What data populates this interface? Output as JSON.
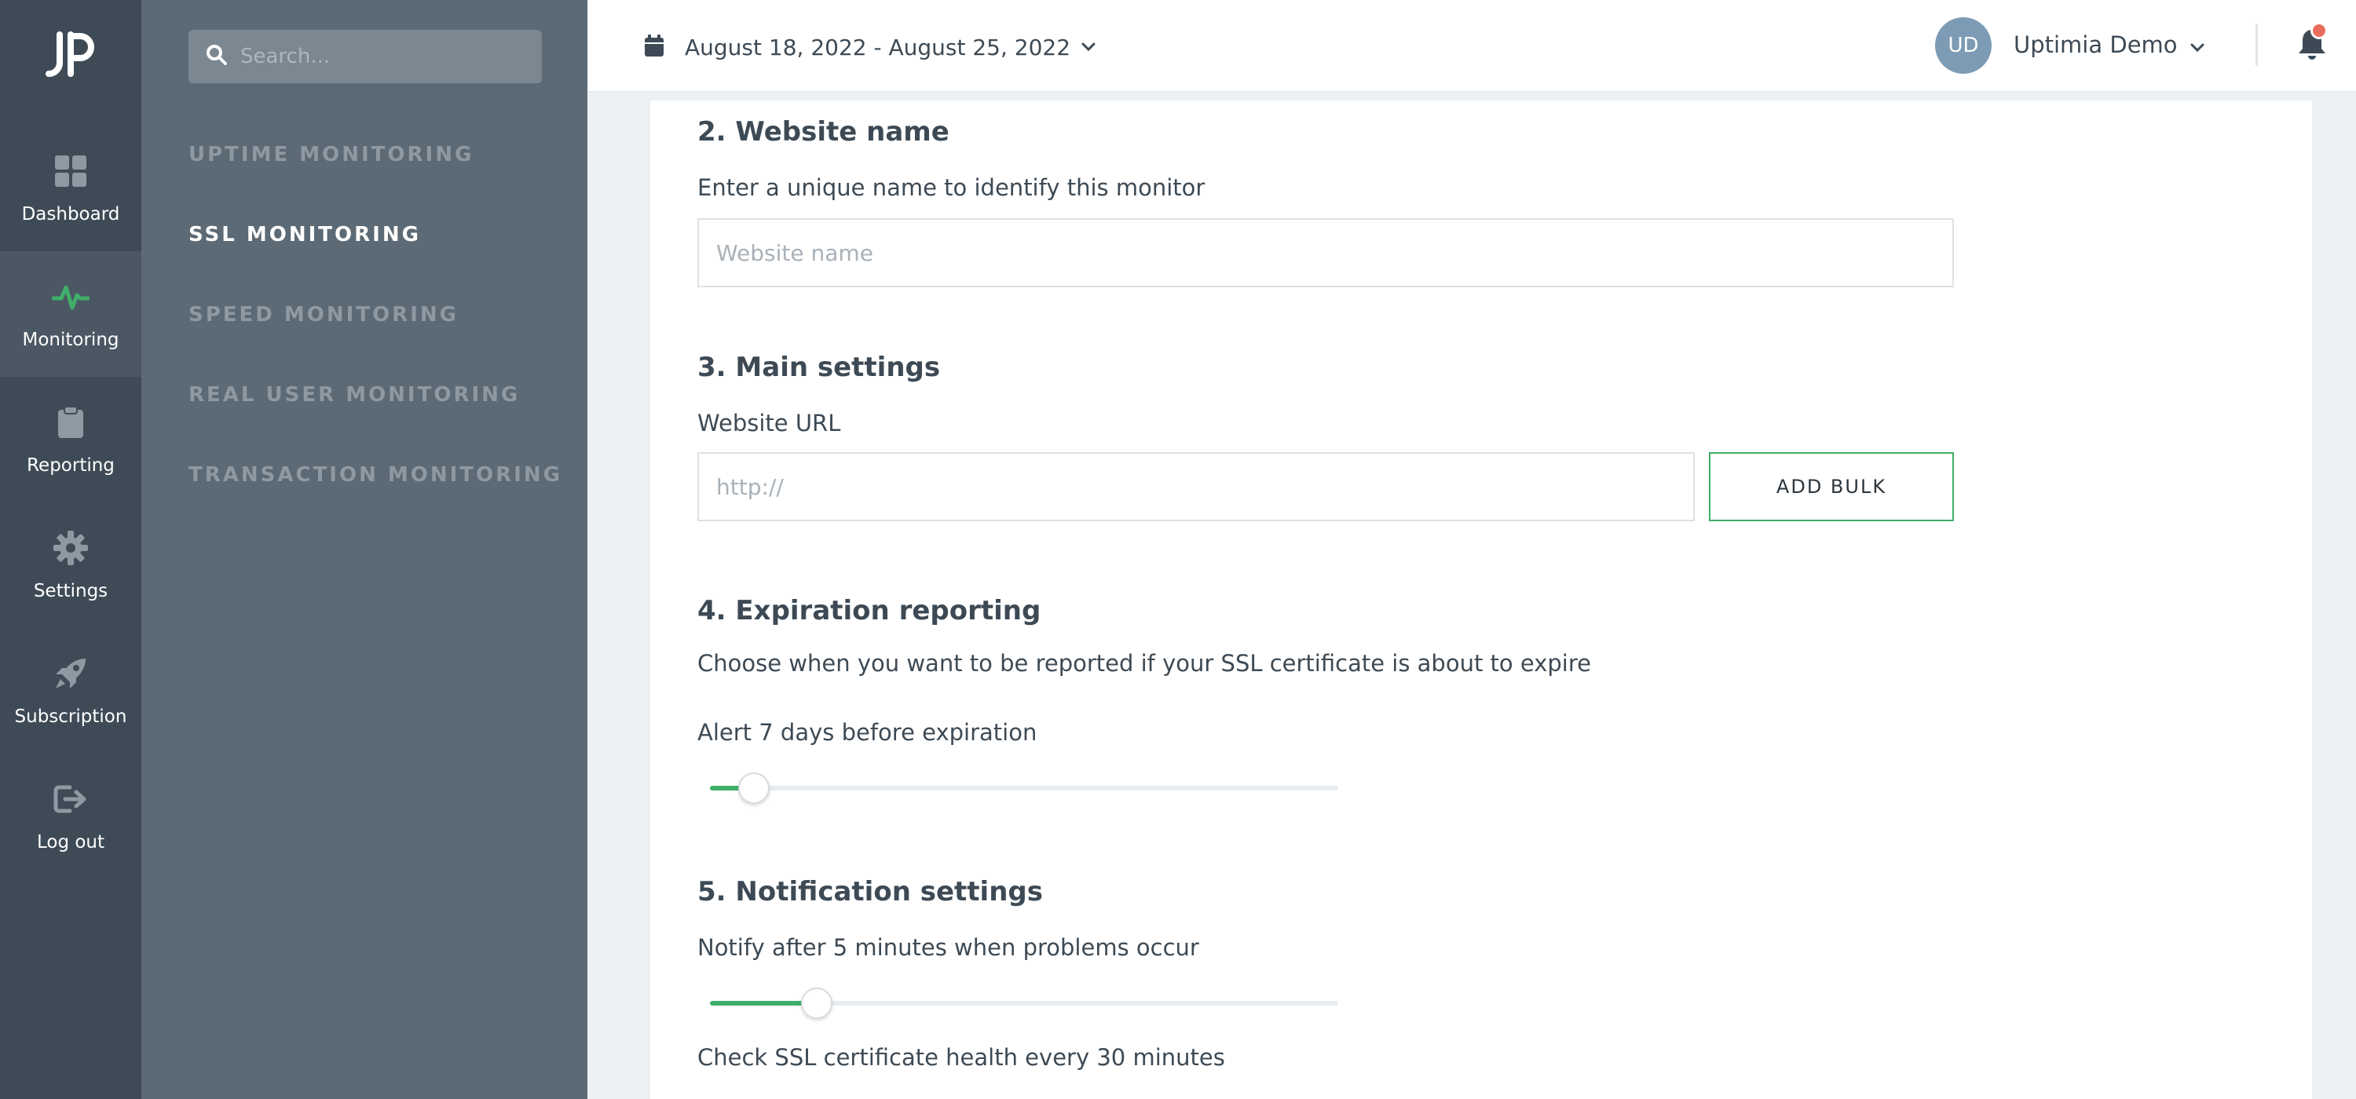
{
  "rail": {
    "items": [
      {
        "label": "Dashboard",
        "icon": "dashboard-icon"
      },
      {
        "label": "Monitoring",
        "icon": "pulse-icon"
      },
      {
        "label": "Reporting",
        "icon": "clipboard-icon"
      },
      {
        "label": "Settings",
        "icon": "gear-icon"
      },
      {
        "label": "Subscription",
        "icon": "rocket-icon"
      },
      {
        "label": "Log out",
        "icon": "logout-icon"
      }
    ]
  },
  "search": {
    "placeholder": "Search..."
  },
  "subnav": {
    "items": [
      {
        "label": "UPTIME MONITORING"
      },
      {
        "label": "SSL MONITORING"
      },
      {
        "label": "SPEED MONITORING"
      },
      {
        "label": "REAL USER MONITORING"
      },
      {
        "label": "TRANSACTION MONITORING"
      }
    ]
  },
  "header": {
    "date_range": "August 18, 2022 - August 25, 2022",
    "avatar_initials": "UD",
    "user_name": "Uptimia Demo"
  },
  "form": {
    "website_name": {
      "title": "2. Website name",
      "description": "Enter a unique name to identify this monitor",
      "placeholder": "Website name"
    },
    "main_settings": {
      "title": "3. Main settings",
      "url_label": "Website URL",
      "url_placeholder": "http://",
      "add_bulk_label": "ADD BULK"
    },
    "expiration": {
      "title": "4. Expiration reporting",
      "description": "Choose when you want to be reported if your SSL certificate is about to expire",
      "alert_label": "Alert 7 days before expiration",
      "alert_slider_fraction": 0.07
    },
    "notification": {
      "title": "5. Notification settings",
      "notify_label": "Notify after 5 minutes when problems occur",
      "notify_slider_fraction": 0.17,
      "check_label": "Check SSL certificate health every 30 minutes"
    }
  },
  "colors": {
    "accent": "#3fae69",
    "rail_bg": "#3e4b56",
    "subnav_bg": "#5c6a75",
    "notification_dot": "#e96d5b"
  }
}
